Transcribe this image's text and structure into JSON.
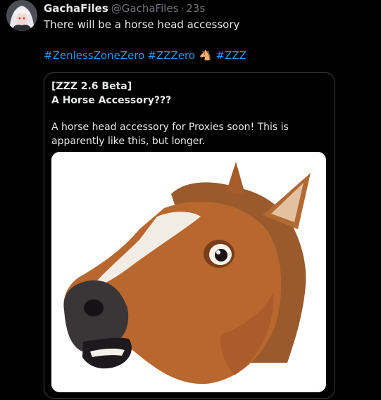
{
  "tweet": {
    "display_name": "GachaFiles",
    "handle": "@GachaFiles",
    "separator": "·",
    "time": "23s",
    "text": "There will be a horse head accessory",
    "hashtags": [
      "#ZenlessZoneZero",
      "#ZZZero",
      "#ZZZ"
    ],
    "emoji": "🐴",
    "avatar_icon": "anime-character-avatar"
  },
  "quote": {
    "title_line1": "[ZZZ 2.6 Beta]",
    "title_line2": "A Horse Accessory???",
    "body_line1": "A horse head accessory for Proxies soon! This is",
    "body_line2": "apparently like this, but longer.",
    "image_icon": "horse-head-mask-image"
  },
  "colors": {
    "background": "#000000",
    "text": "#e7e9ea",
    "muted": "#71767b",
    "link": "#1d9bf0",
    "border": "#3e4144"
  }
}
